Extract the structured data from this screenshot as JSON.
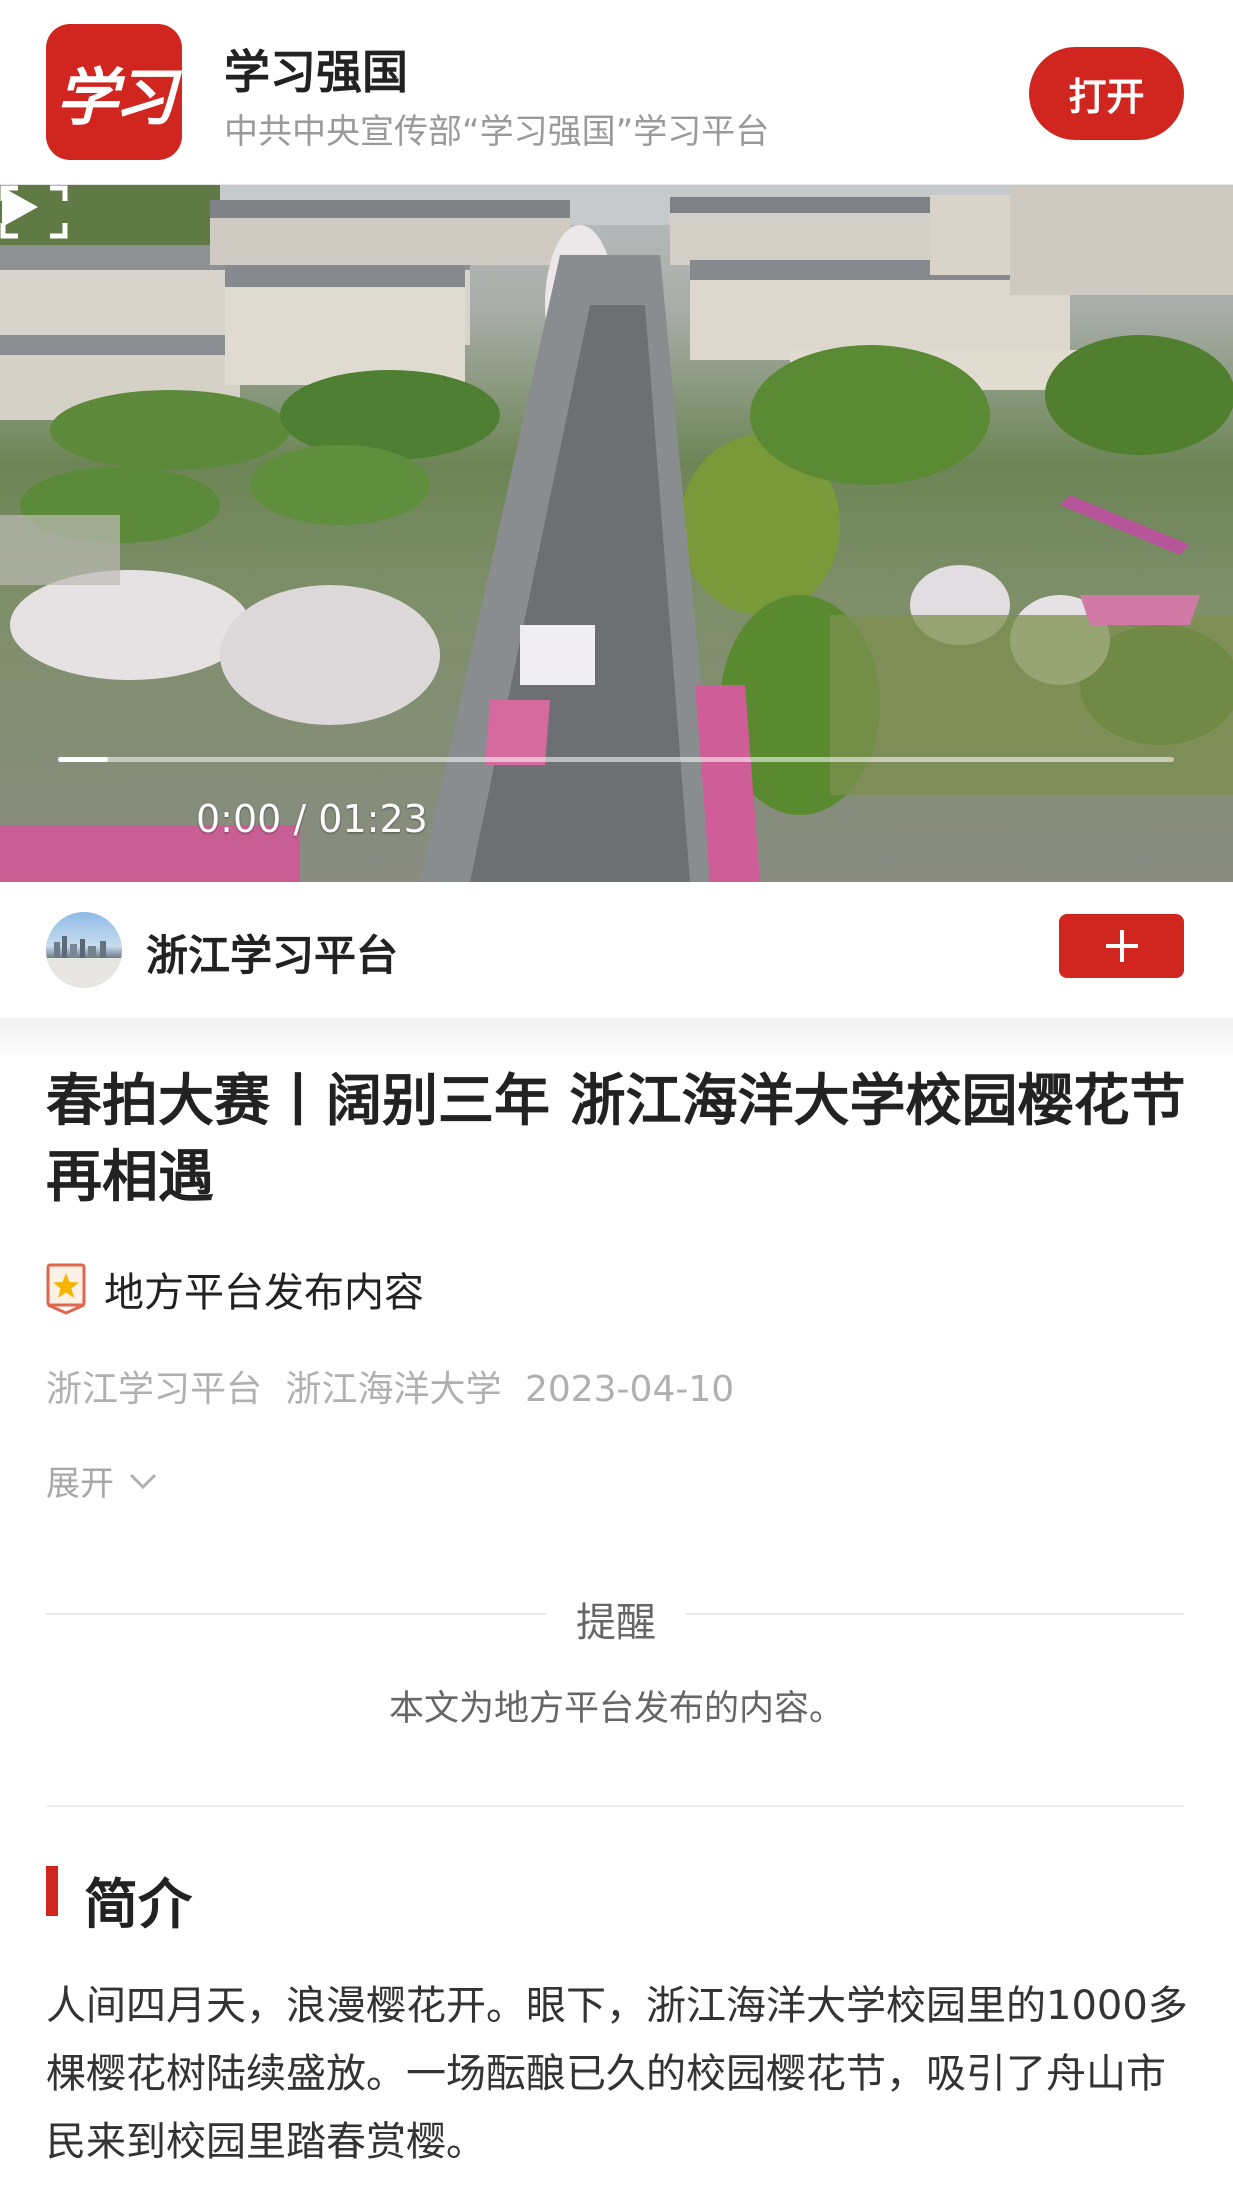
{
  "app_banner": {
    "logo_text": "学习",
    "app_name": "学习强国",
    "subtitle": "中共中央宣传部“学习强国”学习平台",
    "open_label": "打开",
    "accent_color": "#d0261f"
  },
  "video": {
    "time_display": "0:00 / 01:23",
    "progress": 0.045,
    "play_icon": "play-icon",
    "fullscreen_icon": "fullscreen-icon"
  },
  "channel": {
    "name": "浙江学习平台",
    "follow_icon": "plus-icon"
  },
  "article": {
    "title": "春拍大赛丨阔别三年 浙江海洋大学校园樱花节再相遇",
    "source_label": "地方平台发布内容",
    "meta": {
      "platform": "浙江学习平台",
      "publisher": "浙江海洋大学",
      "date": "2023-04-10"
    },
    "expand_label": "展开"
  },
  "notice": {
    "title": "提醒",
    "body": "本文为地方平台发布的内容。"
  },
  "intro": {
    "heading": "简介",
    "text": "人间四月天，浪漫樱花开。眼下，浙江海洋大学校园里的1000多棵樱花树陆续盛放。一场酝酿已久的校园樱花节，吸引了舟山市民来到校园里踏春赏樱。"
  }
}
